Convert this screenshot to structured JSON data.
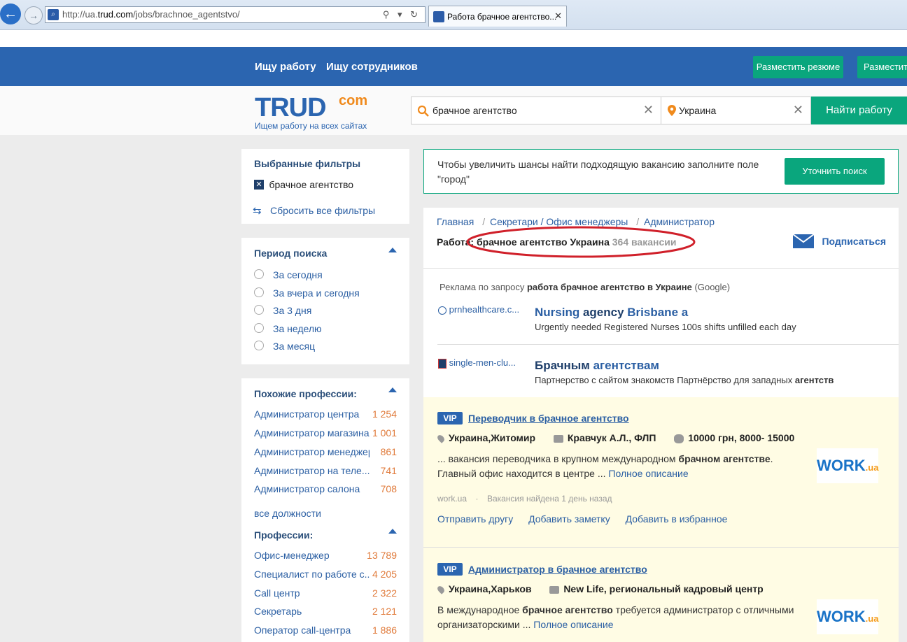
{
  "browser": {
    "url_prefix": "http://ua.",
    "url_domain": "trud.com",
    "url_path": "/jobs/brachnoe_agentstvo/",
    "tab_title": "Работа брачное агентство...",
    "addr_icons": "⚲ ▾ ↻"
  },
  "header": {
    "nav_jobs": "Ищу работу",
    "nav_employees": "Ищу сотрудников",
    "btn_resume": "Разместить резюме",
    "btn_vacancy": "Разместить"
  },
  "logo": {
    "main": "TRUD",
    "sup": "com",
    "tagline": "Ищем работу на всех сайтах"
  },
  "search": {
    "query": "брачное агентство",
    "location": "Украина",
    "button": "Найти работу"
  },
  "filters": {
    "title": "Выбранные фильтры",
    "active": "брачное агентство",
    "reset": "Сбросить все фильтры"
  },
  "period": {
    "title": "Период поиска",
    "options": [
      "За сегодня",
      "За вчера и сегодня",
      "За 3 дня",
      "За неделю",
      "За месяц"
    ]
  },
  "similar": {
    "title": "Похожие профессии:",
    "items": [
      {
        "name": "Администратор центра",
        "count": "1 254"
      },
      {
        "name": "Администратор магазина",
        "count": "1 001"
      },
      {
        "name": "Администратор менеджер",
        "count": "861"
      },
      {
        "name": "Администратор на теле...",
        "count": "741"
      },
      {
        "name": "Администратор салона",
        "count": "708"
      }
    ],
    "all": "все должности"
  },
  "professions": {
    "title": "Профессии:",
    "items": [
      {
        "name": "Офис-менеджер",
        "count": "13 789"
      },
      {
        "name": "Специалист по работе с...",
        "count": "4 205"
      },
      {
        "name": "Call центр",
        "count": "2 322"
      },
      {
        "name": "Секретарь",
        "count": "2 121"
      },
      {
        "name": "Оператор call-центра",
        "count": "1 886"
      }
    ]
  },
  "notice": {
    "text": "Чтобы увеличить шансы найти подходящую вакансию заполните поле \"город\"",
    "button": "Уточнить поиск"
  },
  "breadcrumb": {
    "home": "Главная",
    "sep": "/",
    "cat": "Секретари / Офис менеджеры",
    "sub": "Администратор"
  },
  "results": {
    "prefix": "Работа:",
    "query": "брачное агентство Украина",
    "count": "364 вакансии",
    "subscribe": "Подписаться"
  },
  "ads": {
    "label_prefix": "Реклама по запросу",
    "label_query": "работа брачное агентство в Украине",
    "label_suffix": "(Google)",
    "items": [
      {
        "site": "prnhealthcare.c...",
        "title_a": "Nursing ",
        "title_b": "agency",
        "title_c": " Brisbane a",
        "desc": "Urgently needed Registered Nurses 100s shifts unfilled each day"
      },
      {
        "site": "single-men-clu...",
        "title_a": "",
        "title_b": "Брачным",
        "title_c": " агентствам",
        "desc_a": "Партнерство с сайтом знакомств Партнёрство для западных ",
        "desc_b": "агентств"
      }
    ]
  },
  "jobs": [
    {
      "badge": "VIP",
      "title": "Переводчик в брачное агентство",
      "location": "Украина,Житомир",
      "company": "Кравчук А.Л., ФЛП",
      "salary": "10000 грн, 8000- 15000",
      "desc_a": "... вакансия переводчика в крупном международном ",
      "desc_b": "брачном агентстве",
      "desc_c": ". Главный офис находится в центре ... ",
      "more": "Полное описание",
      "source": "work.ua",
      "dot": "·",
      "found": "Вакансия найдена 1 день назад",
      "action_send": "Отправить другу",
      "action_note": "Добавить заметку",
      "action_fav": "Добавить в избранное",
      "logo_main": "WORK",
      "logo_sub": ".ua"
    },
    {
      "badge": "VIP",
      "title": "Администратор в брачное агентство",
      "location": "Украина,Харьков",
      "company": "New Life, региональный кадровый центр",
      "desc_a": "В международное ",
      "desc_b": "брачное агентство",
      "desc_c": " требуется администратор с отличными организаторскими ... ",
      "more": "Полное описание",
      "logo_main": "WORK",
      "logo_sub": ".ua"
    }
  ]
}
